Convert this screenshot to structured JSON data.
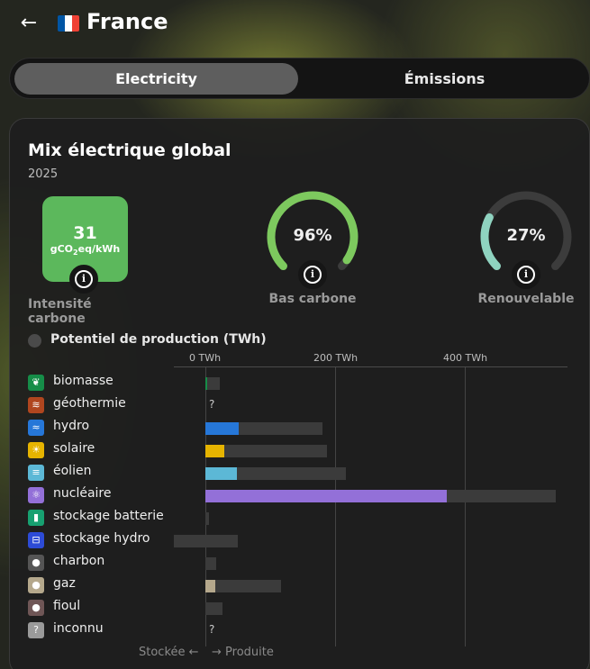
{
  "header": {
    "back_icon": "arrow-left-icon",
    "flag_icon": "france-flag-icon",
    "flag_colors": [
      "#0055a4",
      "#ffffff",
      "#ef4135"
    ],
    "country": "France"
  },
  "tabs": [
    {
      "label": "Electricity",
      "active": true
    },
    {
      "label": "Émissions",
      "active": false
    }
  ],
  "card": {
    "title": "Mix électrique global",
    "year": "2025",
    "carbon_intensity": {
      "value": "31",
      "unit_main": "gCO",
      "unit_sub": "2",
      "unit_tail": "eq/kWh",
      "label": "Intensité carbone",
      "color": "#5cb85c",
      "info_icon": "info-icon"
    },
    "low_carbon": {
      "value_text": "96%",
      "value": 0.96,
      "label": "Bas carbone",
      "color": "#7dc95e",
      "info_icon": "info-icon"
    },
    "renewable": {
      "value_text": "27%",
      "value": 0.27,
      "label": "Renouvelable",
      "color": "#8fd3c0",
      "info_icon": "info-icon"
    },
    "production_toggle": "Potentiel de production (TWh)",
    "axis_ticks": [
      "0 TWh",
      "200 TWh",
      "400 TWh"
    ],
    "footer": {
      "stored": "Stockée",
      "produced": "Produite",
      "stored_arrow": "←",
      "produced_arrow": "→"
    }
  },
  "chart_data": {
    "type": "bar",
    "orientation": "horizontal",
    "xlabel": "",
    "ylabel": "",
    "x_ticks": [
      "0 TWh",
      "200 TWh",
      "400 TWh"
    ],
    "xlim": [
      -50,
      560
    ],
    "categories": [
      "biomasse",
      "géothermie",
      "hydro",
      "solaire",
      "éolien",
      "nucléaire",
      "stockage batterie",
      "stockage hydro",
      "charbon",
      "gaz",
      "fioul",
      "inconnu"
    ],
    "series": [
      {
        "name": "Produite",
        "values": [
          3,
          null,
          52,
          29,
          49,
          372,
          0,
          0,
          0,
          15,
          0,
          null
        ]
      },
      {
        "name": "Potentiel de production (TWh)",
        "values": [
          22,
          null,
          180,
          187,
          217,
          540,
          6,
          50,
          16,
          116,
          27,
          null
        ]
      }
    ],
    "storage_negative": {
      "stockage hydro": -48
    },
    "colors": {
      "biomasse": "#168d48",
      "géothermie": "#b0461f",
      "hydro": "#2677d8",
      "solaire": "#e6b400",
      "éolien": "#5cb8d6",
      "nucléaire": "#9370d8",
      "stockage batterie": "#17a070",
      "stockage hydro": "#2d4bd6",
      "charbon": "#555555",
      "gaz": "#b5a88c",
      "fioul": "#6f5656",
      "inconnu": "#9a9a9a"
    },
    "icons": {
      "biomasse": "leaf-icon",
      "géothermie": "heat-icon",
      "hydro": "waves-icon",
      "solaire": "sun-icon",
      "éolien": "wind-icon",
      "nucléaire": "atom-icon",
      "stockage batterie": "battery-icon",
      "stockage hydro": "reservoir-icon",
      "charbon": "drop-icon",
      "gaz": "flame-icon",
      "fioul": "oil-drop-icon",
      "inconnu": "question-icon"
    },
    "glyphs": {
      "biomasse": "❦",
      "géothermie": "≋",
      "hydro": "≈",
      "solaire": "☀",
      "éolien": "≡",
      "nucléaire": "⚛",
      "stockage batterie": "▮",
      "stockage hydro": "⊟",
      "charbon": "●",
      "gaz": "●",
      "fioul": "●",
      "inconnu": "?"
    },
    "unknown_marker": "?"
  }
}
